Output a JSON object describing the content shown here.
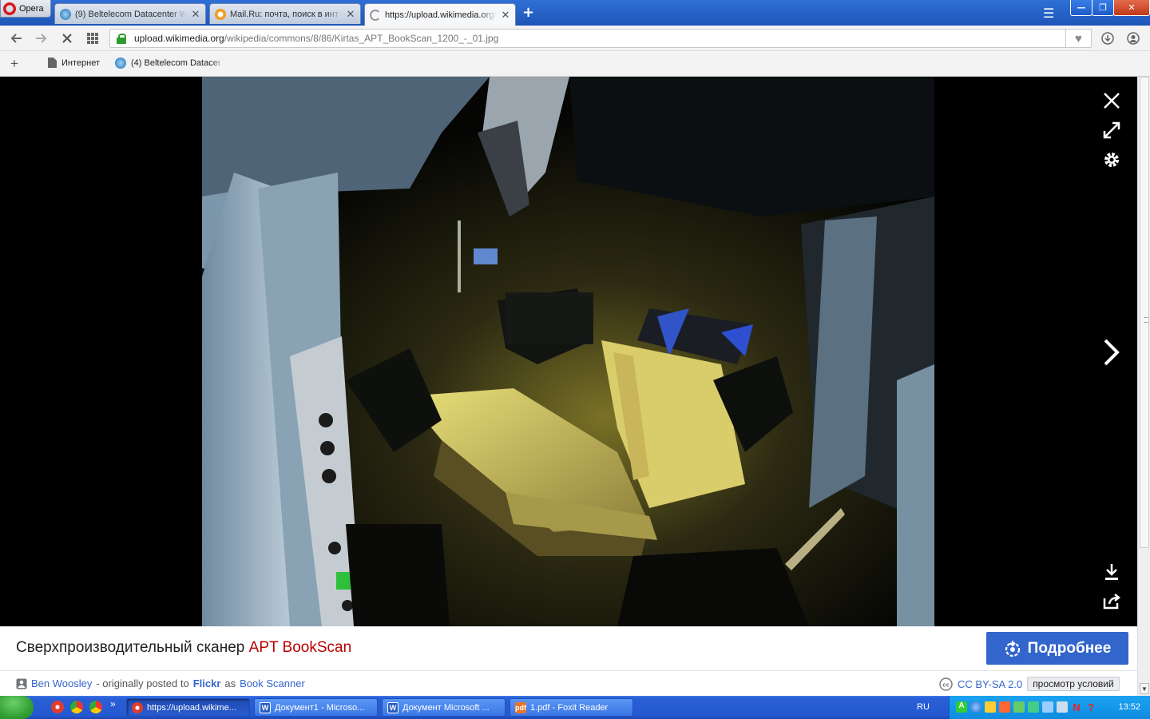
{
  "browser": {
    "opera_label": "Opera",
    "tabs": [
      {
        "title": "(9) Beltelecom Datacenter W",
        "close": "✕"
      },
      {
        "title": "Mail.Ru: почта, поиск в инт",
        "close": "✕"
      },
      {
        "title": "https://upload.wikimedia.org/",
        "close": "✕"
      }
    ],
    "url_host": "upload.wikimedia.org",
    "url_path": "/wikipedia/commons/8/86/Kirtas_APT_BookScan_1200_-_01.jpg",
    "bookmarks": [
      {
        "label": "Интернет"
      },
      {
        "label": "(4) Beltelecom Datacent"
      }
    ]
  },
  "caption": {
    "title_prefix": "Сверхпроизводительный сканер ",
    "title_highlight": "APT BookScan",
    "details_button": "Подробнее",
    "author": "Ben Woosley",
    "posted_text": "- originally posted to",
    "platform": "Flickr",
    "as_text": "as",
    "photo_title": "Book Scanner",
    "license": "CC BY-SA 2.0",
    "terms_button": "просмотр условий"
  },
  "taskbar": {
    "tasks": [
      {
        "label": "https://upload.wikime..."
      },
      {
        "label": "Документ1 - Microso..."
      },
      {
        "label": "Документ Microsoft ..."
      },
      {
        "label": "1.pdf - Foxit Reader"
      }
    ],
    "language": "RU",
    "clock": "13:52"
  },
  "colors": {
    "accent": "#3366cc",
    "highlight_red": "#ba0000",
    "xp_blue": "#2458d0"
  }
}
